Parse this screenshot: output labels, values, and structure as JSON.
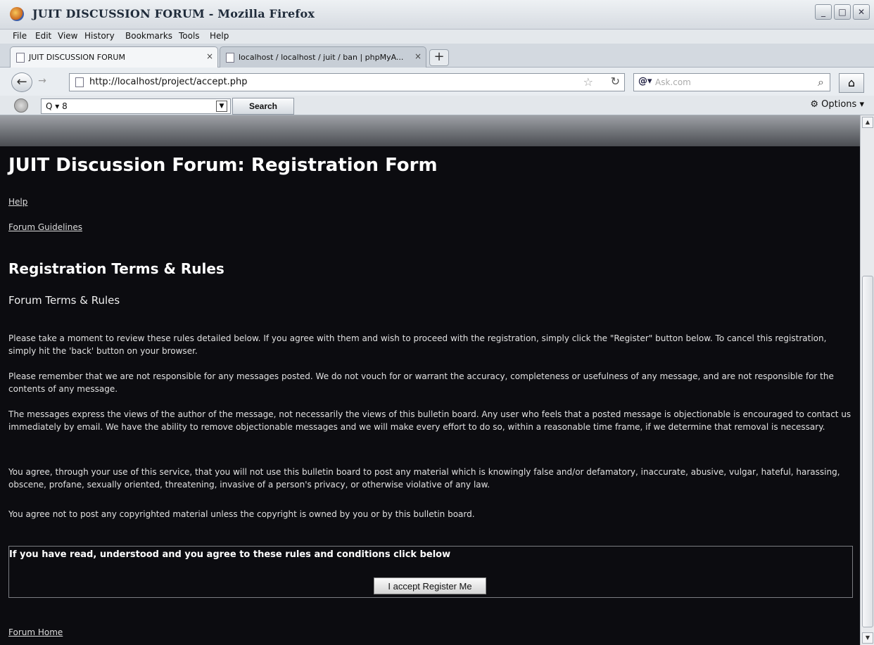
{
  "window": {
    "title": "JUIT DISCUSSION FORUM - Mozilla Firefox"
  },
  "menu": [
    "File",
    "Edit",
    "View",
    "History",
    "Bookmarks",
    "Tools",
    "Help"
  ],
  "tabs": [
    {
      "label": "JUIT DISCUSSION FORUM",
      "close": "×"
    },
    {
      "label": "localhost / localhost / juit / ban | phpMyA...",
      "close": "×"
    }
  ],
  "newtab": "+",
  "nav": {
    "url": "http://localhost/project/accept.php",
    "search_placeholder": "Ask.com",
    "back": "←",
    "forward": "→",
    "star": "☆",
    "reload": "↻",
    "home": "⌂"
  },
  "toolbar": {
    "query": "Q ▾ 8",
    "search_label": "Search",
    "options_label": "Options"
  },
  "page": {
    "title": "JUIT Discussion Forum: Registration Form",
    "links": {
      "help": "Help",
      "guidelines": "Forum Guidelines",
      "home": "Forum Home"
    },
    "section_title": "Registration Terms & Rules",
    "subsection_title": "Forum Terms & Rules",
    "paragraphs": [
      "Please take a moment to review these rules detailed below. If you agree with them and wish to proceed with the registration, simply click the \"Register\" button below. To cancel this registration, simply hit the 'back' button on your browser.",
      "Please remember that we are not responsible for any messages posted. We do not vouch for or warrant the accuracy, completeness or usefulness of any message, and are not responsible for the contents of any message.",
      "The messages express the views of the author of the message, not necessarily the views of this bulletin board. Any user who feels that a posted message is objectionable is encouraged to contact us immediately by email. We have the ability to remove objectionable messages and we will make every effort to do so, within a reasonable time frame, if we determine that removal is necessary.",
      "You agree, through your use of this service, that you will not use this bulletin board to post any material which is knowingly false and/or defamatory, inaccurate, abusive, vulgar, hateful, harassing, obscene, profane, sexually oriented, threatening, invasive of a person's privacy, or otherwise violative of any law.",
      "You agree not to post any copyrighted material unless the copyright is owned by you or by this bulletin board."
    ],
    "agree_text": "If you have read, understood and you agree to these rules and conditions click below",
    "accept_button": "I accept Register Me"
  },
  "scrollbar": {
    "up": "▲",
    "down": "▼"
  },
  "colors": {
    "page_background": "#0c0c10",
    "banner": "#7d8085",
    "text": "#e8e8ea"
  }
}
